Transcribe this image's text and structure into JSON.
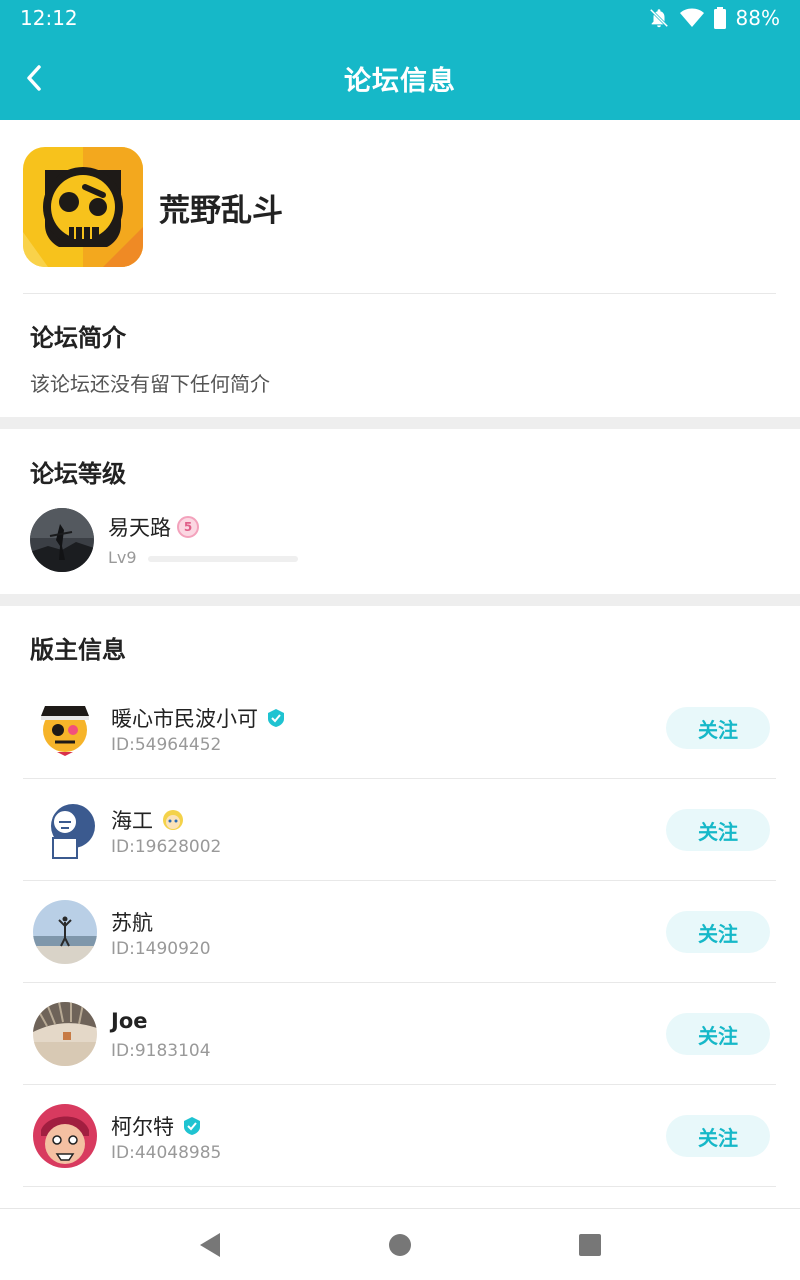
{
  "status_bar": {
    "time": "12:12",
    "battery": "88%"
  },
  "app_bar": {
    "title": "论坛信息"
  },
  "forum": {
    "name": "荒野乱斗"
  },
  "intro": {
    "title": "论坛简介",
    "text": "该论坛还没有留下任何简介"
  },
  "level": {
    "title": "论坛等级",
    "user_name": "易天路",
    "badge": "5",
    "level_label": "Lv9",
    "progress": 0
  },
  "moderators": {
    "title": "版主信息",
    "follow_label": "关注",
    "items": [
      {
        "name": "暖心市民波小可",
        "id": "ID:54964452",
        "verified": true
      },
      {
        "name": "海工",
        "id": "ID:19628002",
        "verified": false
      },
      {
        "name": "苏航",
        "id": "ID:1490920",
        "verified": false
      },
      {
        "name": "Joe",
        "id": "ID:9183104",
        "verified": false
      },
      {
        "name": "柯尔特",
        "id": "ID:44048985",
        "verified": true
      }
    ]
  },
  "colors": {
    "accent": "#16b8c8",
    "follow_bg": "#e8f8fa"
  }
}
